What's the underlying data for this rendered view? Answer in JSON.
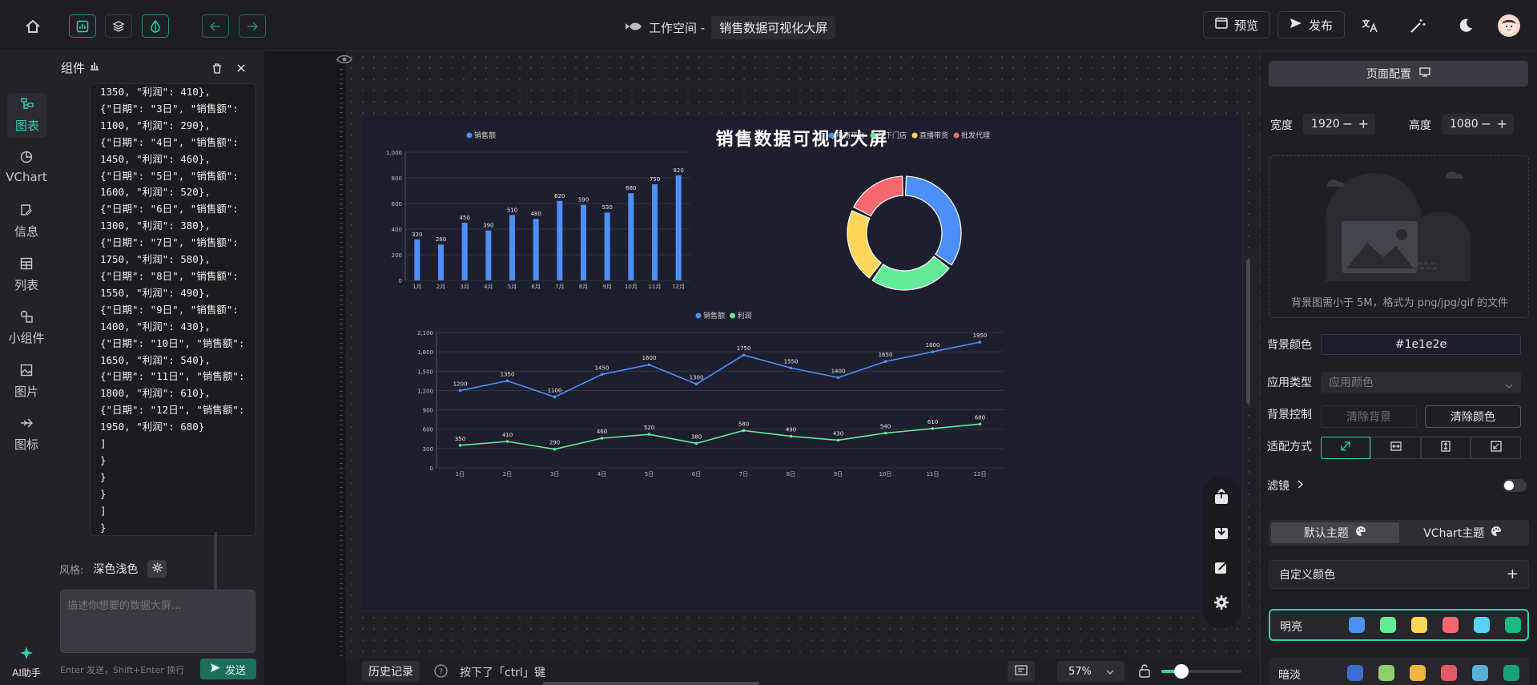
{
  "header": {
    "workspace": "工作空间 -",
    "title": "销售数据可视化大屏",
    "preview": "预览",
    "publish": "发布"
  },
  "panel": {
    "title": "组件",
    "style_label": "风格:",
    "style_value": "深色浅色",
    "input_placeholder": "描述你想要的数据大屏...",
    "hint": "Enter 发送，Shift+Enter 换行",
    "send": "发送",
    "code_lines": [
      "1350, \"利润\": 410},",
      "{\"日期\": \"3日\", \"销售额\":",
      "1100, \"利润\": 290},",
      "{\"日期\": \"4日\", \"销售额\":",
      "1450, \"利润\": 460},",
      "{\"日期\": \"5日\", \"销售额\":",
      "1600, \"利润\": 520},",
      "{\"日期\": \"6日\", \"销售额\":",
      "1300, \"利润\": 380},",
      "{\"日期\": \"7日\", \"销售额\":",
      "1750, \"利润\": 580},",
      "{\"日期\": \"8日\", \"销售额\":",
      "1550, \"利润\": 490},",
      "{\"日期\": \"9日\", \"销售额\":",
      "1400, \"利润\": 430},",
      "{\"日期\": \"10日\", \"销售额\":",
      "1650, \"利润\": 540},",
      "{\"日期\": \"11日\", \"销售额\":",
      "1800, \"利润\": 610},",
      "{\"日期\": \"12日\", \"销售额\":",
      "1950, \"利润\": 680}",
      "]",
      "}",
      "}",
      "}",
      "]",
      "}"
    ]
  },
  "rail": {
    "chart": "图表",
    "vchart": "VChart",
    "info": "信息",
    "list": "列表",
    "widget": "小组件",
    "image": "图片",
    "icon": "图标",
    "ai": "AI助手"
  },
  "board": {
    "title": "销售数据可视化大屏"
  },
  "chart_data": [
    {
      "type": "bar",
      "title": "",
      "series": [
        {
          "name": "销售额",
          "values": [
            320,
            280,
            450,
            390,
            510,
            480,
            620,
            590,
            530,
            680,
            750,
            820
          ]
        }
      ],
      "categories": [
        "1月",
        "2月",
        "3月",
        "4月",
        "5月",
        "6月",
        "7月",
        "8月",
        "9月",
        "10月",
        "11月",
        "12月"
      ],
      "ylim": [
        0,
        1000
      ],
      "yticks": [
        "0",
        "200",
        "400",
        "600",
        "800",
        "1,000"
      ],
      "color": "#4d8ff8",
      "legend": "top"
    },
    {
      "type": "pie",
      "variant": "donut",
      "categories": [
        "电商平台",
        "线下门店",
        "直播带货",
        "批发代理"
      ],
      "values": [
        35,
        25,
        22,
        18
      ],
      "colors": [
        "#4d8ff8",
        "#63ea96",
        "#fdd65a",
        "#f56870"
      ],
      "legend": "top-right"
    },
    {
      "type": "line",
      "categories": [
        "1日",
        "2日",
        "3日",
        "4日",
        "5日",
        "6日",
        "7日",
        "8日",
        "9日",
        "10日",
        "11日",
        "12日"
      ],
      "ylim": [
        0,
        2100
      ],
      "yticks": [
        "0",
        "300",
        "600",
        "900",
        "1,200",
        "1,500",
        "1,800",
        "2,100"
      ],
      "series": [
        {
          "name": "销售额",
          "values": [
            1200,
            1350,
            1100,
            1450,
            1600,
            1300,
            1750,
            1550,
            1400,
            1650,
            1800,
            1950
          ],
          "color": "#4d8ff8"
        },
        {
          "name": "利润",
          "values": [
            350,
            410,
            290,
            460,
            520,
            380,
            580,
            490,
            430,
            540,
            610,
            680
          ],
          "color": "#63ea96"
        }
      ],
      "legend": "top"
    }
  ],
  "status": {
    "history": "历史记录",
    "ctrl_hint": "按下了「ctrl」键",
    "zoom": "57%"
  },
  "right": {
    "page_config": "页面配置",
    "width_label": "宽度",
    "width": "1920",
    "height_label": "高度",
    "height": "1080",
    "upload_hint": "背景图需小于 5M，格式为 png/jpg/gif 的文件",
    "bgcolor_label": "背景颜色",
    "bgcolor": "#1e1e2e",
    "apply_label": "应用类型",
    "apply_value": "应用颜色",
    "bgctrl_label": "背景控制",
    "clear_bg": "清除背景",
    "clear_color": "清除颜色",
    "fit_label": "适配方式",
    "filter_label": "滤镜",
    "theme_default": "默认主题",
    "theme_vchart": "VChart主题",
    "custom_color": "自定义颜色",
    "palette_bright": "明亮",
    "palette_dark": "暗淡",
    "bright_colors": [
      "#4d8ff8",
      "#63ea96",
      "#fdd65a",
      "#f56870",
      "#5bd1f5",
      "#19b981"
    ],
    "dark_colors": [
      "#3b6fd4",
      "#8fcf6a",
      "#f2b640",
      "#e05a63",
      "#5aaed8",
      "#17a37a"
    ]
  }
}
